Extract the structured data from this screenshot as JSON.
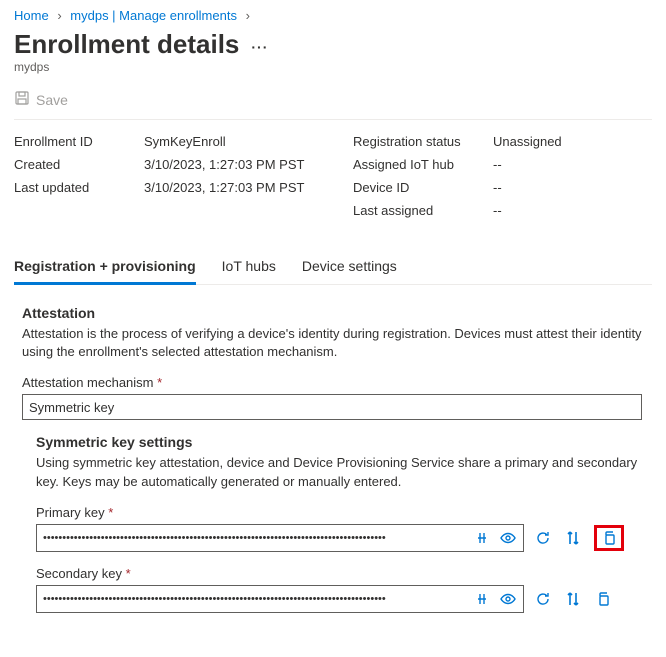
{
  "breadcrumb": {
    "home": "Home",
    "mid": "mydps | Manage enrollments"
  },
  "page": {
    "title": "Enrollment details",
    "subtitle": "mydps"
  },
  "toolbar": {
    "save_label": "Save"
  },
  "details": {
    "left": {
      "enrollment_id_label": "Enrollment ID",
      "enrollment_id": "SymKeyEnroll",
      "created_label": "Created",
      "created": "3/10/2023, 1:27:03 PM PST",
      "last_updated_label": "Last updated",
      "last_updated": "3/10/2023, 1:27:03 PM PST"
    },
    "right": {
      "registration_status_label": "Registration status",
      "registration_status": "Unassigned",
      "assigned_hub_label": "Assigned IoT hub",
      "assigned_hub": "--",
      "device_id_label": "Device ID",
      "device_id": "--",
      "last_assigned_label": "Last assigned",
      "last_assigned": "--"
    }
  },
  "tabs": {
    "reg": "Registration + provisioning",
    "hubs": "IoT hubs",
    "device": "Device settings"
  },
  "attestation": {
    "heading": "Attestation",
    "desc": "Attestation is the process of verifying a device's identity during registration. Devices must attest their identity using the enrollment's selected attestation mechanism.",
    "mechanism_label": "Attestation mechanism",
    "mechanism_value": "Symmetric key"
  },
  "symkey": {
    "heading": "Symmetric key settings",
    "desc": "Using symmetric key attestation, device and Device Provisioning Service share a primary and secondary key. Keys may be automatically generated or manually entered.",
    "primary_label": "Primary key",
    "secondary_label": "Secondary key",
    "masked": "•••••••••••••••••••••••••••••••••••••••••••••••••••••••••••••••••••••••••••••••••••••••••"
  }
}
